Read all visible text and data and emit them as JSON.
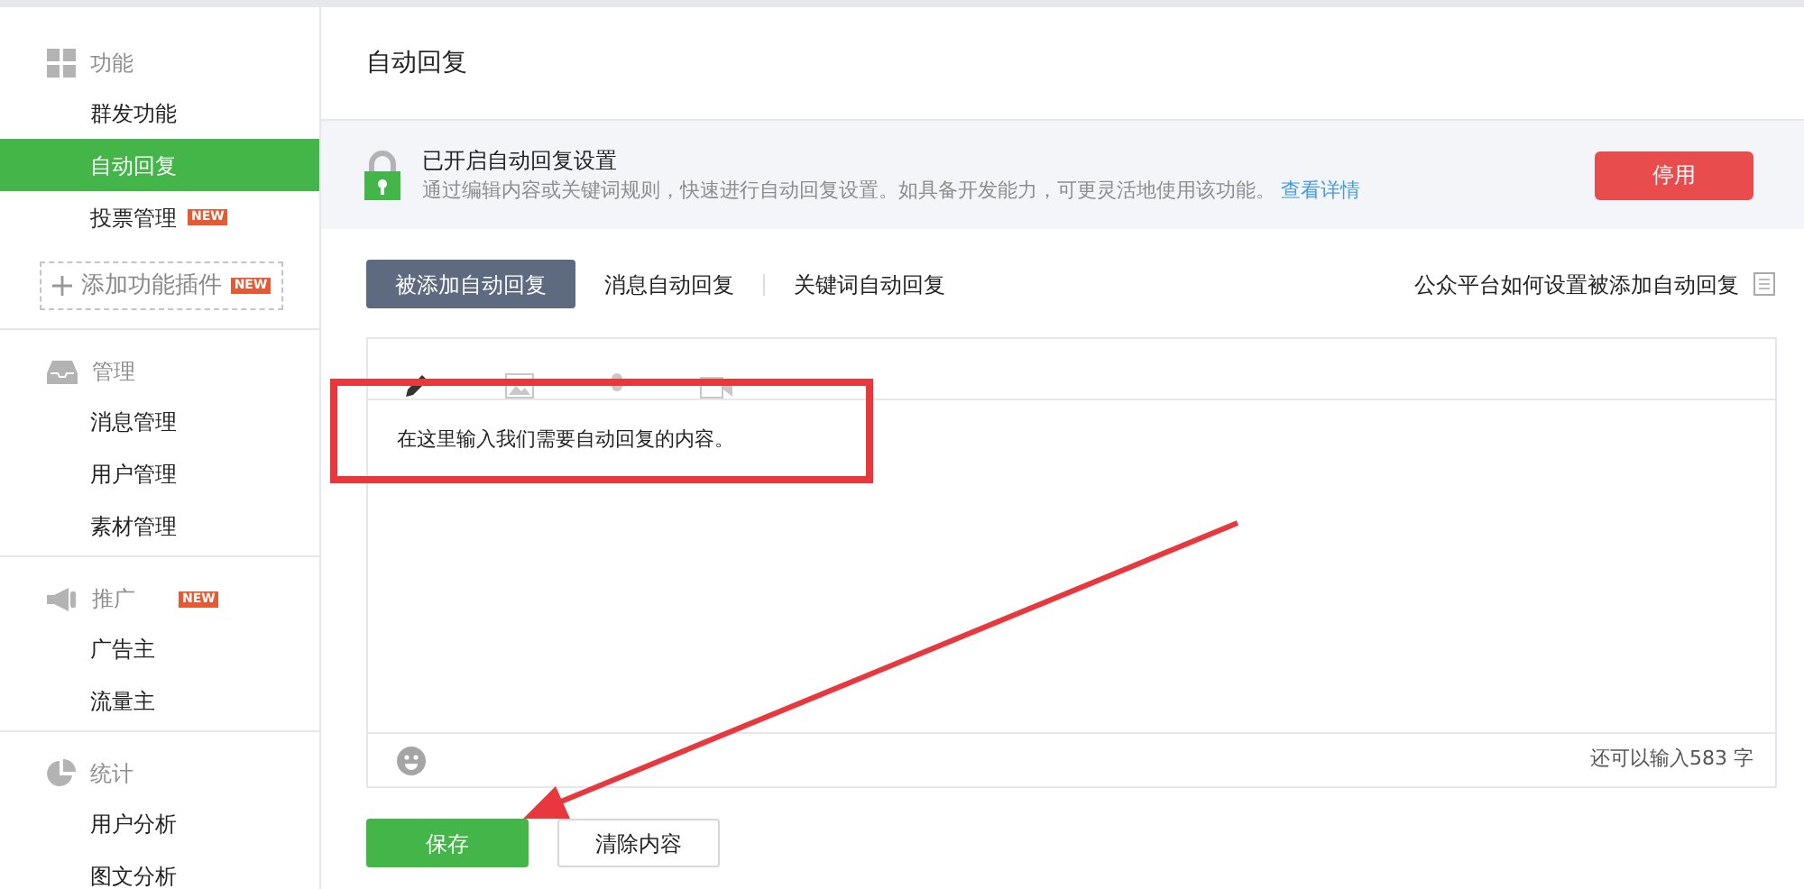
{
  "sidebar": {
    "sections": [
      {
        "title": "功能",
        "items": [
          {
            "label": "群发功能",
            "selected": false
          },
          {
            "label": "自动回复",
            "selected": true
          },
          {
            "label": "投票管理",
            "selected": false,
            "badge": "NEW"
          }
        ],
        "add_button": {
          "label": "添加功能插件",
          "badge": "NEW"
        }
      },
      {
        "title": "管理",
        "items": [
          {
            "label": "消息管理",
            "selected": false
          },
          {
            "label": "用户管理",
            "selected": false
          },
          {
            "label": "素材管理",
            "selected": false
          }
        ]
      },
      {
        "title": "推广",
        "badge": "NEW",
        "items": [
          {
            "label": "广告主",
            "selected": false
          },
          {
            "label": "流量主",
            "selected": false
          }
        ]
      },
      {
        "title": "统计",
        "items": [
          {
            "label": "用户分析",
            "selected": false
          },
          {
            "label": "图文分析",
            "selected": false
          }
        ]
      }
    ]
  },
  "page_title": "自动回复",
  "banner": {
    "title": "已开启自动回复设置",
    "text": "通过编辑内容或关键词规则，快速进行自动回复设置。如具备开发能力，可更灵活地使用该功能。",
    "link": "查看详情",
    "button": "停用"
  },
  "tabs": [
    {
      "label": "被添加自动回复",
      "selected": true
    },
    {
      "label": "消息自动回复",
      "selected": false
    },
    {
      "label": "关键词自动回复",
      "selected": false
    }
  ],
  "help_link": "公众平台如何设置被添加自动回复",
  "editor": {
    "tools": [
      {
        "selected": true
      },
      {
        "selected": false
      },
      {
        "selected": false
      },
      {
        "selected": false
      }
    ],
    "value": "在这里输入我们需要自动回复的内容。",
    "counter": "还可以输入583 字"
  },
  "buttons": [
    {
      "label": "保存",
      "kind": "primary"
    },
    {
      "label": "清除内容",
      "kind": "secondary"
    }
  ]
}
